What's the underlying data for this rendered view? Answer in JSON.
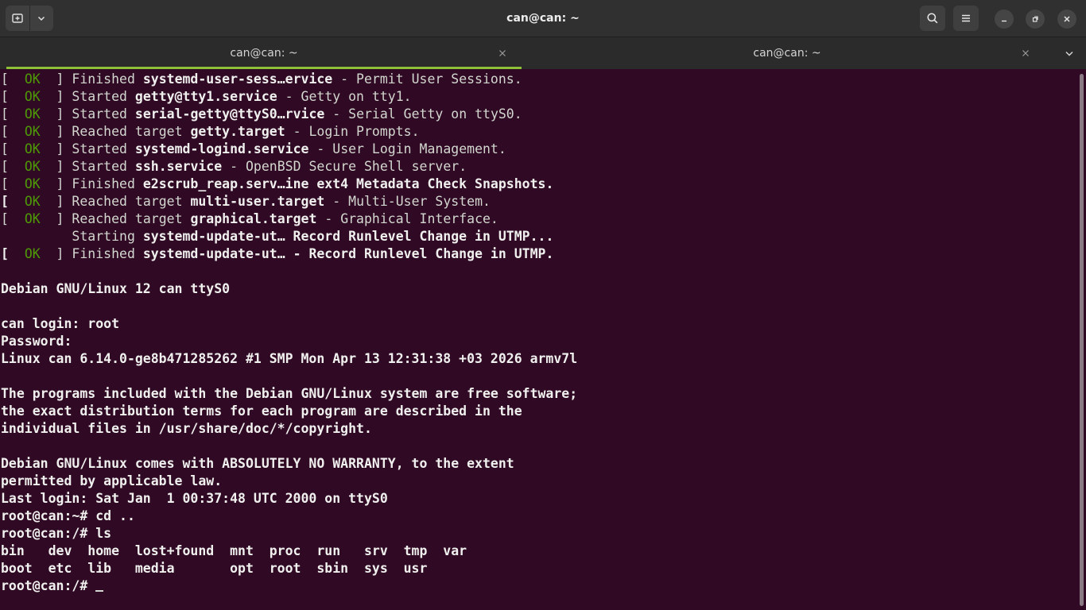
{
  "window": {
    "title": "can@can: ~"
  },
  "tabs": [
    {
      "label": "can@can: ~",
      "active": true
    },
    {
      "label": "can@can: ~",
      "active": false
    }
  ],
  "colors": {
    "accent": "#8ec038",
    "ok": "#4e9a06",
    "background": "#300a24"
  },
  "icons": {
    "new_tab": "new-tab-icon",
    "dropdown": "chevron-down-icon",
    "search": "search-icon",
    "menu": "hamburger-menu-icon",
    "minimize": "minimize-icon",
    "maximize": "maximize-icon",
    "close": "close-icon"
  },
  "terminal": {
    "lines": [
      [
        {
          "t": "[  "
        },
        {
          "t": "OK",
          "c": "ok"
        },
        {
          "t": "  ] Finished "
        },
        {
          "t": "systemd-user-sess…ervice",
          "c": "b"
        },
        {
          "t": " - Permit User Sessions."
        }
      ],
      [
        {
          "t": "[  "
        },
        {
          "t": "OK",
          "c": "ok"
        },
        {
          "t": "  ] Started "
        },
        {
          "t": "getty@tty1.service",
          "c": "b"
        },
        {
          "t": " - Getty on tty1."
        }
      ],
      [
        {
          "t": "[  "
        },
        {
          "t": "OK",
          "c": "ok"
        },
        {
          "t": "  ] Started "
        },
        {
          "t": "serial-getty@ttyS0…rvice",
          "c": "b"
        },
        {
          "t": " - Serial Getty on ttyS0."
        }
      ],
      [
        {
          "t": "[  "
        },
        {
          "t": "OK",
          "c": "ok"
        },
        {
          "t": "  ] Reached target "
        },
        {
          "t": "getty.target",
          "c": "b"
        },
        {
          "t": " - Login Prompts."
        }
      ],
      [
        {
          "t": "[  "
        },
        {
          "t": "OK",
          "c": "ok"
        },
        {
          "t": "  ] Started "
        },
        {
          "t": "systemd-logind.service",
          "c": "b"
        },
        {
          "t": " - User Login Management."
        }
      ],
      [
        {
          "t": "[  "
        },
        {
          "t": "OK",
          "c": "ok"
        },
        {
          "t": "  ] Started "
        },
        {
          "t": "ssh.service",
          "c": "b"
        },
        {
          "t": " - OpenBSD Secure Shell server."
        }
      ],
      [
        {
          "t": "[  "
        },
        {
          "t": "OK",
          "c": "ok"
        },
        {
          "t": "  ] Finished "
        },
        {
          "t": "e2scrub_reap.serv…ine ext4 Metadata Check Snapshots.",
          "c": "b"
        }
      ],
      [
        {
          "t": "[",
          "c": "b"
        },
        {
          "t": "  "
        },
        {
          "t": "OK",
          "c": "ok"
        },
        {
          "t": "  ] Reached target "
        },
        {
          "t": "multi-user.target",
          "c": "b"
        },
        {
          "t": " - Multi-User System."
        }
      ],
      [
        {
          "t": "[  "
        },
        {
          "t": "OK",
          "c": "ok"
        },
        {
          "t": "  ] Reached target "
        },
        {
          "t": "graphical.target",
          "c": "b"
        },
        {
          "t": " - Graphical Interface."
        }
      ],
      [
        {
          "t": "         Starting "
        },
        {
          "t": "systemd-update-ut… Record Runlevel Change in UTMP...",
          "c": "b"
        }
      ],
      [
        {
          "t": "[",
          "c": "b"
        },
        {
          "t": "  "
        },
        {
          "t": "OK",
          "c": "ok"
        },
        {
          "t": "  ] Finished "
        },
        {
          "t": "systemd-update-ut… - Record Runlevel Change in UTMP.",
          "c": "b"
        }
      ],
      [
        {
          "t": ""
        }
      ],
      [
        {
          "t": "Debian GNU/Linux 12 can ttyS0",
          "c": "b"
        }
      ],
      [
        {
          "t": ""
        }
      ],
      [
        {
          "t": "can login: root",
          "c": "b"
        }
      ],
      [
        {
          "t": "Password:",
          "c": "b"
        }
      ],
      [
        {
          "t": "Linux can 6.14.0-ge8b471285262 #1 SMP Mon Apr 13 12:31:38 +03 2026 armv7l",
          "c": "b"
        }
      ],
      [
        {
          "t": ""
        }
      ],
      [
        {
          "t": "The programs included with the Debian GNU/Linux system are free software;",
          "c": "b"
        }
      ],
      [
        {
          "t": "the exact distribution terms for each program are described in the",
          "c": "b"
        }
      ],
      [
        {
          "t": "individual files in /usr/share/doc/*/copyright.",
          "c": "b"
        }
      ],
      [
        {
          "t": ""
        }
      ],
      [
        {
          "t": "Debian GNU/Linux comes with ABSOLUTELY NO WARRANTY, to the extent",
          "c": "b"
        }
      ],
      [
        {
          "t": "permitted by applicable law.",
          "c": "b"
        }
      ],
      [
        {
          "t": "Last login: Sat Jan  1 00:37:48 UTC 2000 on ttyS0",
          "c": "b"
        }
      ],
      [
        {
          "t": "root@can:~# cd ..",
          "c": "b"
        }
      ],
      [
        {
          "t": "root@can:/# ls",
          "c": "b"
        }
      ],
      [
        {
          "t": "bin   dev  home  lost+found  mnt  proc  run   srv  tmp  var",
          "c": "b"
        }
      ],
      [
        {
          "t": "boot  etc  lib   media       opt  root  sbin  sys  usr",
          "c": "b"
        }
      ],
      [
        {
          "t": "root@can:/# ",
          "c": "b"
        }
      ]
    ]
  }
}
